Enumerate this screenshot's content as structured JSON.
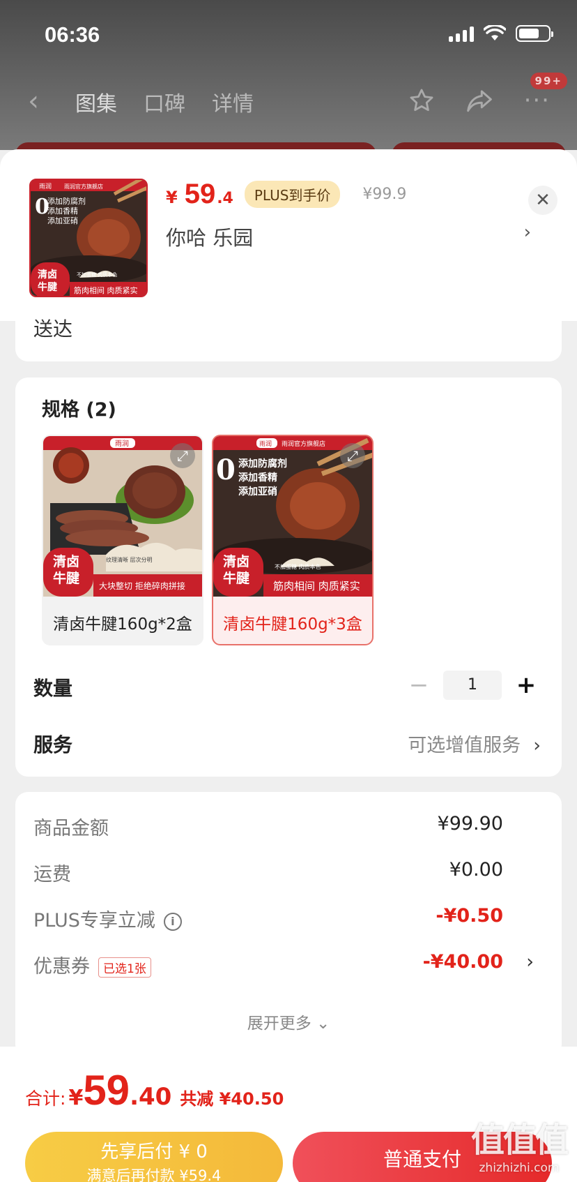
{
  "status_bar": {
    "time": "06:36"
  },
  "nav": {
    "tabs": [
      {
        "label": "图集",
        "active": true
      },
      {
        "label": "口碑",
        "active": false
      },
      {
        "label": "详情",
        "active": false
      }
    ],
    "more_badge": "99+",
    "icons": [
      "back-chevron-icon",
      "star-icon",
      "share-icon",
      "more-dots-icon"
    ]
  },
  "product": {
    "price_symbol": "¥",
    "price_int": "59",
    "price_dec": ".4",
    "plus_label": "PLUS到手价",
    "original_price": "¥99.9",
    "address": "你哈  乐园",
    "delivery_text": "送达",
    "thumb": {
      "brand": "雨润",
      "store": "雨润官方旗舰店",
      "claims": [
        "添加防腐剂",
        "添加香精",
        "添加亚硝"
      ],
      "zero": "0",
      "badge": [
        "清卤",
        "牛腱"
      ],
      "sub_tag": "不加蛋糖  肉质本色",
      "banner": "筋肉相间 肉质紧实"
    }
  },
  "spec": {
    "title": "规格 (2)",
    "options": [
      {
        "label": "清卤牛腱160g*2盒",
        "selected": false,
        "brand": "雨润",
        "badge": [
          "清卤",
          "牛腱"
        ],
        "sub_tag": "纹理清晰  层次分明",
        "banner": "大块整切 拒绝碎肉拼接"
      },
      {
        "label": "清卤牛腱160g*3盒",
        "selected": true,
        "brand": "雨润",
        "store": "雨润官方旗舰店",
        "claims": [
          "添加防腐剂",
          "添加香精",
          "添加亚硝"
        ],
        "badge": [
          "清卤",
          "牛腱"
        ],
        "sub_tag": "不加蛋糖  肉质本色",
        "banner": "筋肉相间 肉质紧实"
      }
    ]
  },
  "quantity": {
    "label": "数量",
    "value": "1",
    "minus": "−",
    "plus": "+"
  },
  "service": {
    "label": "服务",
    "value": "可选增值服务",
    "chevron": "›"
  },
  "price_breakdown": {
    "items": [
      {
        "label": "商品金额",
        "value": "¥99.90"
      },
      {
        "label": "运费",
        "value": "¥0.00"
      },
      {
        "label": "PLUS专享立减",
        "value": "-¥0.50"
      },
      {
        "label": "优惠券",
        "value": "-¥40.00",
        "tag": "已选1张"
      }
    ],
    "expand_more": "展开更多 ⌄"
  },
  "footer": {
    "total_label": "合计:",
    "total_yen": "¥",
    "total_int": "59",
    "total_dec": ".40",
    "total_saved": "共减 ¥40.50",
    "pay_later_line1": "先享后付 ¥ 0",
    "pay_later_line2": "满意后再付款 ¥59.4",
    "pay_button": "普通支付"
  },
  "watermark": {
    "logo": "值值值",
    "site": "zhizhizhi.com"
  },
  "colors": {
    "accent": "#e2231a",
    "plus_tag_bg": "#fbe7b6",
    "pay_later": "#f4b93a"
  }
}
